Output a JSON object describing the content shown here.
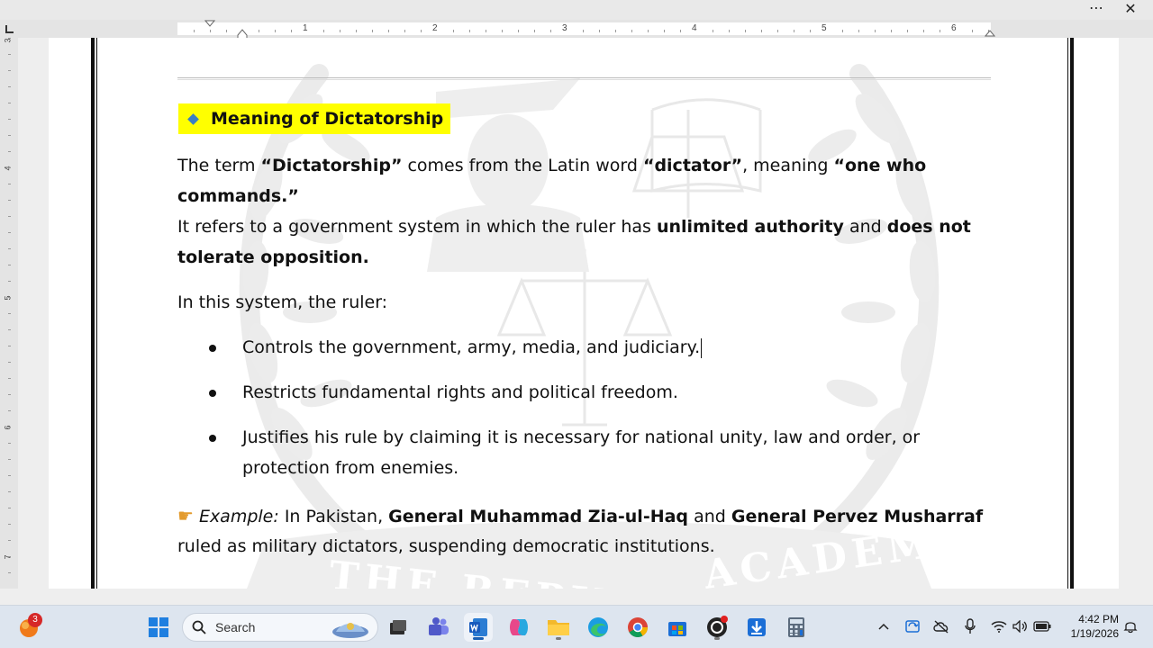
{
  "window": {
    "menu_glyph": "⋯",
    "close_glyph": "✕"
  },
  "ruler": {
    "h_numbers": [
      "1",
      "2",
      "3",
      "4",
      "5",
      "6"
    ],
    "v_numbers": [
      "3",
      "4",
      "5",
      "6",
      "7"
    ]
  },
  "document": {
    "heading": "Meaning of Dictatorship",
    "p1": {
      "s1": "The term ",
      "b1": "“Dictatorship”",
      "s2": " comes from the Latin word ",
      "b2": "“dictator”",
      "s3": ", meaning ",
      "b3": "“one who",
      "b4": "commands.”"
    },
    "p2": {
      "s1": "It refers to a government system in which the ruler has ",
      "b1": "unlimited authority",
      "s2": " and ",
      "b2": "does not",
      "b3": "tolerate opposition."
    },
    "p3": "In this system, the ruler:",
    "bullets": [
      "Controls the government, army, media, and judiciary.",
      "Restricts fundamental rights and political freedom.",
      "Justifies his rule by claiming it is necessary for national unity, law and order, or"
    ],
    "bullet3_cont": "protection from enemies.",
    "example": {
      "label": "Example:",
      "s1": " In Pakistan, ",
      "b1": "General Muhammad Zia-ul-Haq",
      "s2": " and ",
      "b2": "General Pervez Musharraf",
      "line2": "ruled as military dictators, suspending democratic institutions."
    },
    "watermark": {
      "text_left": "THE REPU",
      "text_right": "ACADEMY"
    }
  },
  "taskbar": {
    "start_badge": "3",
    "search_label": "Search",
    "clock_time": "4:42 PM",
    "clock_date": "1/19/2026"
  },
  "colors": {
    "highlight": "#ffff00",
    "diamond": "#3a7fc4",
    "taskbar": "#dde5ef"
  }
}
